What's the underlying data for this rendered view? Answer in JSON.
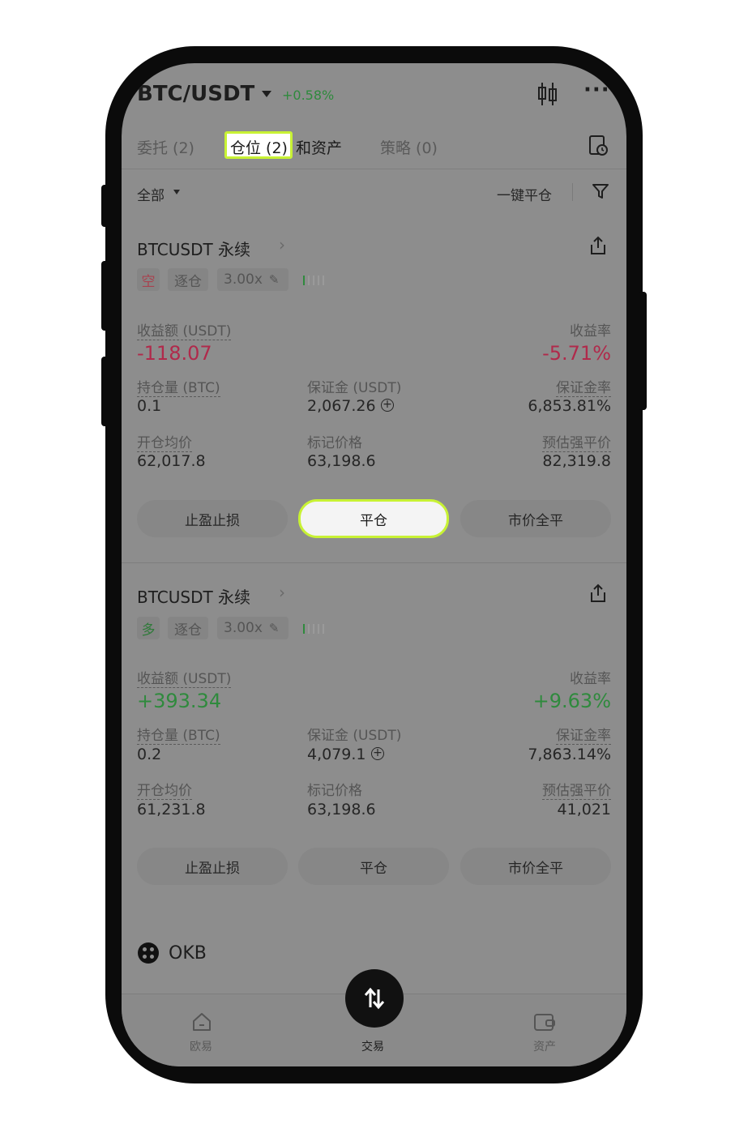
{
  "header": {
    "pair": "BTC/USDT",
    "change": "+0.58%"
  },
  "tabs": [
    {
      "label": "委托 (2)"
    },
    {
      "label": "仓位 (2)"
    },
    {
      "label": "和资产"
    },
    {
      "label": "策略 (0)"
    }
  ],
  "filter_bar": {
    "scope": "全部",
    "close_all": "一键平仓"
  },
  "positions": [
    {
      "title": "BTCUSDT 永续",
      "side": "空",
      "mode": "逐仓",
      "leverage": "3.00x",
      "pnl_label": "收益额 (USDT)",
      "pnl_value": "-118.07",
      "roe_label": "收益率",
      "roe_value": "-5.71%",
      "size_label": "持仓量 (BTC)",
      "size_value": "0.1",
      "margin_label": "保证金 (USDT)",
      "margin_value": "2,067.26",
      "margin_ratio_label": "保证金率",
      "margin_ratio_value": "6,853.81%",
      "entry_label": "开仓均价",
      "entry_value": "62,017.8",
      "mark_label": "标记价格",
      "mark_value": "63,198.6",
      "liq_label": "预估强平价",
      "liq_value": "82,319.8",
      "btn_tpsl": "止盈止损",
      "btn_close": "平仓",
      "btn_market_close": "市价全平"
    },
    {
      "title": "BTCUSDT 永续",
      "side": "多",
      "mode": "逐仓",
      "leverage": "3.00x",
      "pnl_label": "收益额 (USDT)",
      "pnl_value": "+393.34",
      "roe_label": "收益率",
      "roe_value": "+9.63%",
      "size_label": "持仓量 (BTC)",
      "size_value": "0.2",
      "margin_label": "保证金 (USDT)",
      "margin_value": "4,079.1",
      "margin_ratio_label": "保证金率",
      "margin_ratio_value": "7,863.14%",
      "entry_label": "开仓均价",
      "entry_value": "61,231.8",
      "mark_label": "标记价格",
      "mark_value": "63,198.6",
      "liq_label": "预估强平价",
      "liq_value": "41,021",
      "btn_tpsl": "止盈止损",
      "btn_close": "平仓",
      "btn_market_close": "市价全平"
    }
  ],
  "asset": {
    "name": "OKB"
  },
  "bottom_nav": [
    {
      "label": "欧易",
      "icon": "home-icon"
    },
    {
      "label": "交易",
      "icon": "swap-icon"
    },
    {
      "label": "资产",
      "icon": "wallet-icon"
    }
  ],
  "colors": {
    "highlight": "#c8f234",
    "loss": "#b02a4b",
    "profit": "#2f8a3d"
  }
}
